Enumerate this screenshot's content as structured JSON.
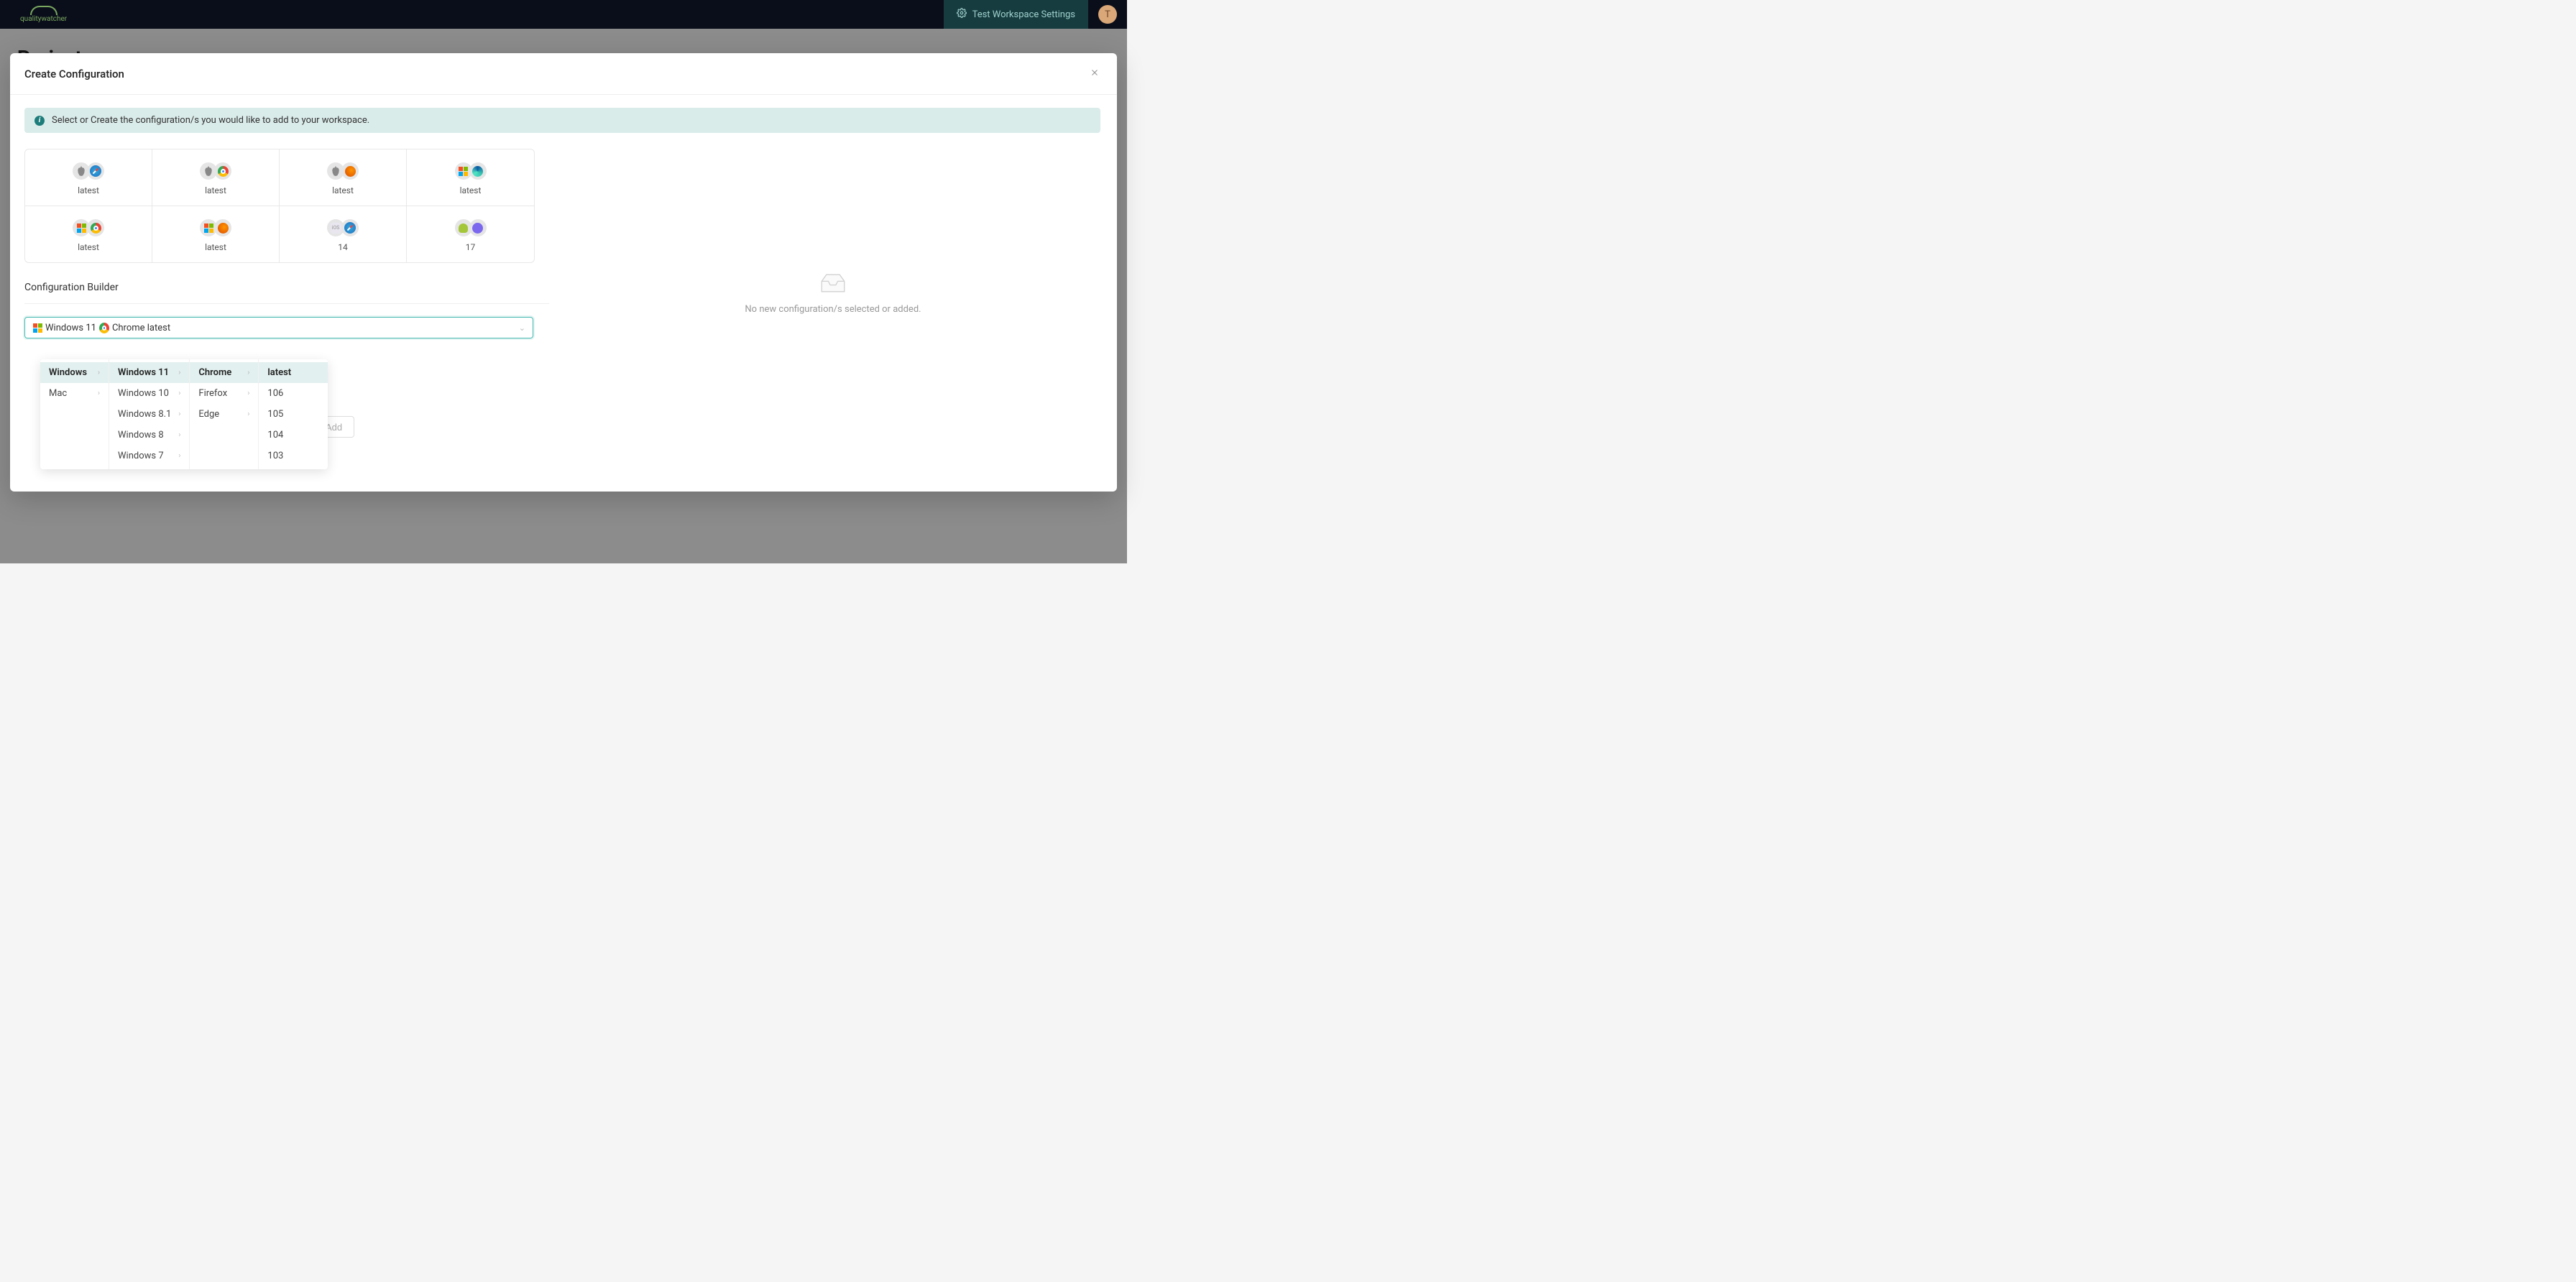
{
  "brand": "qualitywatcher",
  "header": {
    "workspace_settings_label": "Test Workspace Settings",
    "avatar_letter": "T"
  },
  "page": {
    "title": "Projects"
  },
  "modal": {
    "title": "Create Configuration",
    "info_text": "Select or Create the configuration/s you would like to add to your workspace.",
    "builder_title": "Configuration Builder",
    "empty_text": "No new configuration/s selected or added.",
    "add_button": "Add"
  },
  "preset_cards": [
    {
      "os": "mac",
      "browser": "safari",
      "label": "latest"
    },
    {
      "os": "mac",
      "browser": "chrome",
      "label": "latest"
    },
    {
      "os": "mac",
      "browser": "firefox",
      "label": "latest"
    },
    {
      "os": "windows",
      "browser": "edge",
      "label": "latest"
    },
    {
      "os": "windows",
      "browser": "chrome",
      "label": "latest"
    },
    {
      "os": "windows",
      "browser": "firefox",
      "label": "latest"
    },
    {
      "os": "ios",
      "browser": "safari",
      "label": "14"
    },
    {
      "os": "android",
      "browser": "samsung",
      "label": "17"
    }
  ],
  "cascader": {
    "selected_text": "Windows 11 / Chrome latest",
    "icon_os": "windows",
    "icon_browser": "chrome",
    "menus": [
      {
        "items": [
          {
            "label": "Windows",
            "hasChildren": true,
            "active": true
          },
          {
            "label": "Mac",
            "hasChildren": true
          }
        ]
      },
      {
        "items": [
          {
            "label": "Windows 11",
            "hasChildren": true,
            "active": true
          },
          {
            "label": "Windows 10",
            "hasChildren": true
          },
          {
            "label": "Windows 8.1",
            "hasChildren": true
          },
          {
            "label": "Windows 8",
            "hasChildren": true
          },
          {
            "label": "Windows 7",
            "hasChildren": true
          }
        ]
      },
      {
        "items": [
          {
            "label": "Chrome",
            "hasChildren": true,
            "active": true
          },
          {
            "label": "Firefox",
            "hasChildren": true
          },
          {
            "label": "Edge",
            "hasChildren": true
          }
        ]
      },
      {
        "items": [
          {
            "label": "latest",
            "active": true
          },
          {
            "label": "106"
          },
          {
            "label": "105"
          },
          {
            "label": "104"
          },
          {
            "label": "103"
          }
        ]
      }
    ]
  },
  "custom_inputs": {
    "os_value": "",
    "browser_value": ""
  }
}
